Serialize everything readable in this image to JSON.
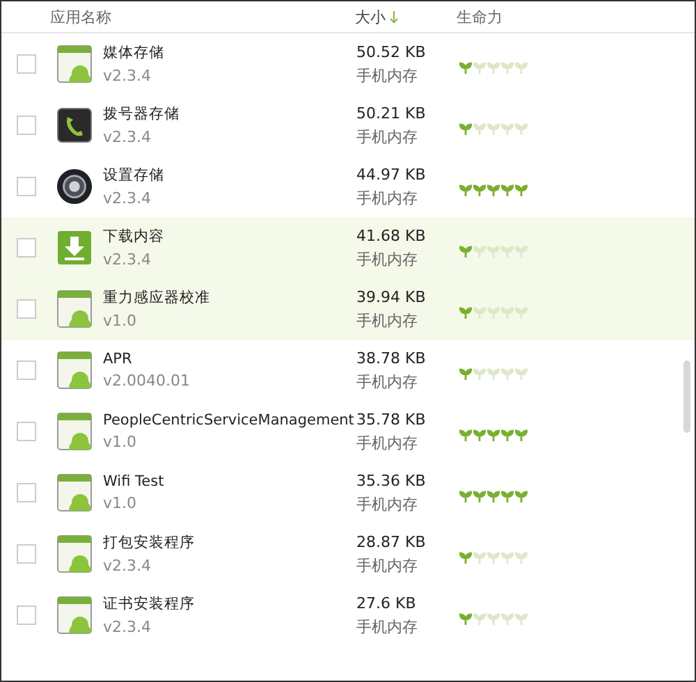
{
  "columns": [
    {
      "label": "应用名称",
      "sorted": false
    },
    {
      "label": "大小",
      "sorted": true
    },
    {
      "label": "生命力",
      "sorted": false
    }
  ],
  "rows": [
    {
      "kind": "android",
      "name": "媒体存储",
      "version": "v2.3.4",
      "size": "50.52 KB",
      "location": "手机内存",
      "stars": 1,
      "checked": false,
      "highlighted": false
    },
    {
      "kind": "phone",
      "name": "拨号器存储",
      "version": "v2.3.4",
      "size": "50.21 KB",
      "location": "手机内存",
      "stars": 1,
      "checked": false,
      "highlighted": false
    },
    {
      "kind": "settings",
      "name": "设置存储",
      "version": "v2.3.4",
      "size": "44.97 KB",
      "location": "手机内存",
      "stars": 5,
      "checked": false,
      "highlighted": false
    },
    {
      "kind": "download",
      "name": "下载内容",
      "version": "v2.3.4",
      "size": "41.68 KB",
      "location": "手机内存",
      "stars": 1,
      "checked": false,
      "highlighted": true
    },
    {
      "kind": "android",
      "name": "重力感应器校准",
      "version": "v1.0",
      "size": "39.94 KB",
      "location": "手机内存",
      "stars": 1,
      "checked": false,
      "highlighted": true
    },
    {
      "kind": "android",
      "name": "APR",
      "version": "v2.0040.01",
      "size": "38.78 KB",
      "location": "手机内存",
      "stars": 1,
      "checked": false,
      "highlighted": false
    },
    {
      "kind": "android",
      "name": "PeopleCentricServiceManagement",
      "version": "v1.0",
      "size": "35.78 KB",
      "location": "手机内存",
      "stars": 5,
      "checked": false,
      "highlighted": false
    },
    {
      "kind": "android",
      "name": "Wifi Test",
      "version": "v1.0",
      "size": "35.36 KB",
      "location": "手机内存",
      "stars": 5,
      "checked": false,
      "highlighted": false
    },
    {
      "kind": "android",
      "name": "打包安装程序",
      "version": "v2.3.4",
      "size": "28.87 KB",
      "location": "手机内存",
      "stars": 1,
      "checked": false,
      "highlighted": false
    },
    {
      "kind": "android",
      "name": "证书安装程序",
      "version": "v2.3.4",
      "size": "27.6 KB",
      "location": "手机内存",
      "stars": 1,
      "checked": false,
      "highlighted": false
    }
  ]
}
